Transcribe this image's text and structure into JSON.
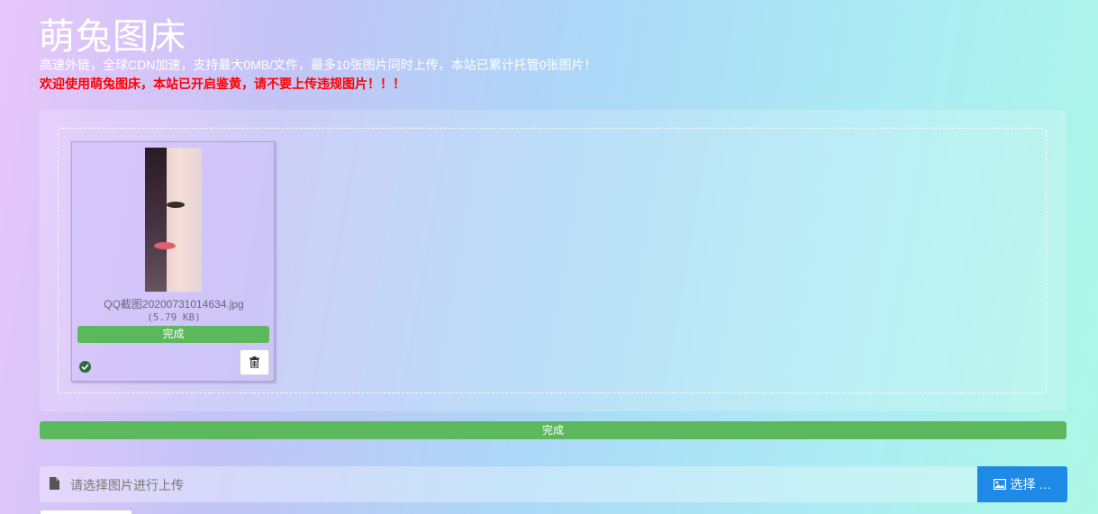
{
  "header": {
    "title": "萌兔图床",
    "subtitle": "高速外链，全球CDN加速，支持最大0MB/文件，最多10张图片同时上传，本站已累计托管0张图片！",
    "warning": "欢迎使用萌兔图床，本站已开启鉴黄，请不要上传违规图片！！！"
  },
  "upload": {
    "files": [
      {
        "name": "QQ截图20200731014634.jpg",
        "size": "(5.79 KB)",
        "status": "完成",
        "progress": 1.0
      }
    ],
    "overall_status": "完成",
    "overall_progress": 1.0
  },
  "file_input": {
    "placeholder": "请选择图片进行上传",
    "browse_label": "选择 …"
  },
  "colors": {
    "success": "#5cb85c",
    "primary": "#1e8ae6",
    "warning_text": "#ff0000"
  },
  "icons": {
    "file": "file-icon",
    "check": "check-circle-icon",
    "trash": "trash-icon",
    "image": "image-icon"
  }
}
